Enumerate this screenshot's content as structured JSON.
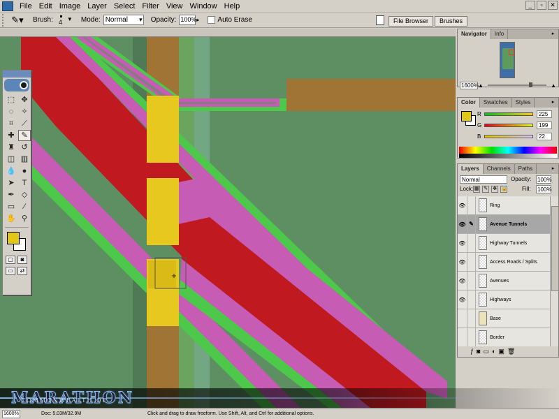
{
  "menubar": {
    "items": [
      "File",
      "Edit",
      "Image",
      "Layer",
      "Select",
      "Filter",
      "View",
      "Window",
      "Help"
    ],
    "controls": [
      "_",
      "▫",
      "✕"
    ]
  },
  "options": {
    "brush_label": "Brush:",
    "brush_size": "4",
    "mode_label": "Mode:",
    "mode_value": "Normal",
    "opacity_label": "Opacity:",
    "opacity_value": "100%",
    "auto_erase_label": "Auto Erase",
    "well_tabs": [
      "File Browser",
      "Brushes"
    ]
  },
  "navigator": {
    "tabs": [
      "Navigator",
      "Info"
    ],
    "zoom": "1600%"
  },
  "color_panel": {
    "tabs": [
      "Color",
      "Swatches",
      "Styles"
    ],
    "r_label": "R",
    "r_value": "225",
    "g_label": "G",
    "g_value": "199",
    "b_label": "B",
    "b_value": "22",
    "foreground": "#e1c716"
  },
  "layers_panel": {
    "tabs": [
      "Layers",
      "Channels",
      "Paths"
    ],
    "blend_mode": "Normal",
    "opacity_label": "Opacity:",
    "opacity_value": "100%",
    "lock_label": "Lock:",
    "fill_label": "Fill:",
    "fill_value": "100%",
    "layers": [
      {
        "name": "Ring",
        "visible": true,
        "selected": false
      },
      {
        "name": "Avenue Tunnels",
        "visible": true,
        "selected": true
      },
      {
        "name": "Highway Tunnels",
        "visible": true,
        "selected": false
      },
      {
        "name": "Access Roads / Splits",
        "visible": true,
        "selected": false
      },
      {
        "name": "Avenues",
        "visible": true,
        "selected": false
      },
      {
        "name": "Highways",
        "visible": true,
        "selected": false
      },
      {
        "name": "Base",
        "visible": false,
        "selected": false
      },
      {
        "name": "Border",
        "visible": false,
        "selected": false
      }
    ]
  },
  "statusbar": {
    "zoom": "1600%",
    "doc_info": "Doc: 5.03M/32.9M",
    "hint": "Click and drag to draw freeform. Use Shift, Alt, and Ctrl for additional options."
  },
  "watermark": {
    "title": "MARATHON",
    "subtitle": "COMMONWEALTH OF"
  },
  "colors": {
    "canvas_green": "#5d8f63",
    "road_red": "#c0191f",
    "road_pink": "#c65cb4",
    "edge_green": "#4dc84b",
    "road_brown": "#a07434",
    "road_yellow": "#e6c81f"
  },
  "icons": {
    "tool_pencil": "pencil-icon"
  }
}
